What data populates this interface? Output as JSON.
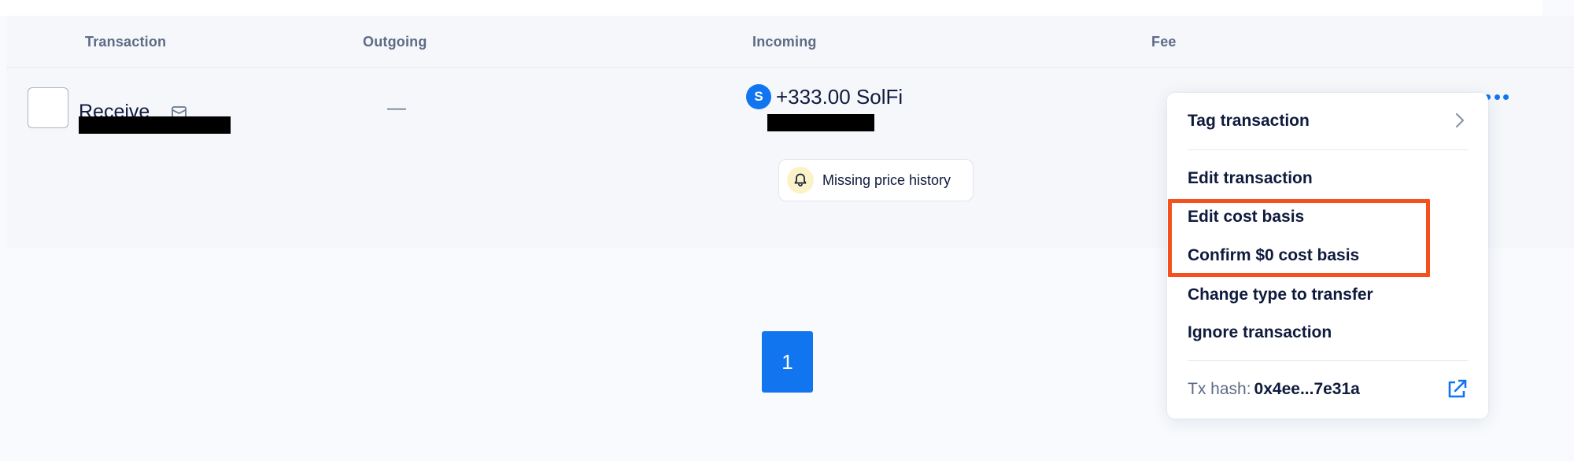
{
  "table": {
    "headers": {
      "transaction": "Transaction",
      "outgoing": "Outgoing",
      "incoming": "Incoming",
      "fee": "Fee"
    },
    "row": {
      "type_label": "Receive",
      "outgoing_value": "—",
      "incoming": {
        "coin_letter": "S",
        "amount": "+333.00 SolFi"
      },
      "warning_label": "Missing price history"
    }
  },
  "pagination": {
    "current_page": "1"
  },
  "menu": {
    "tag_transaction": "Tag transaction",
    "edit_transaction": "Edit transaction",
    "edit_cost_basis": "Edit cost basis",
    "confirm_zero_cost_basis": "Confirm $0 cost basis",
    "change_type_to_transfer": "Change type to transfer",
    "ignore_transaction": "Ignore transaction",
    "tx_hash_label": "Tx hash:",
    "tx_hash_value": "0x4ee...7e31a"
  },
  "colors": {
    "accent": "#1275f0",
    "highlight": "#f4511e",
    "warning_bg": "#fbf3c7"
  },
  "icons": {
    "mail": "mail-icon",
    "coin": "coin-icon",
    "bell": "bell-icon",
    "more": "more-options-icon",
    "chevron": "chevron-right-icon",
    "external": "external-link-icon"
  }
}
